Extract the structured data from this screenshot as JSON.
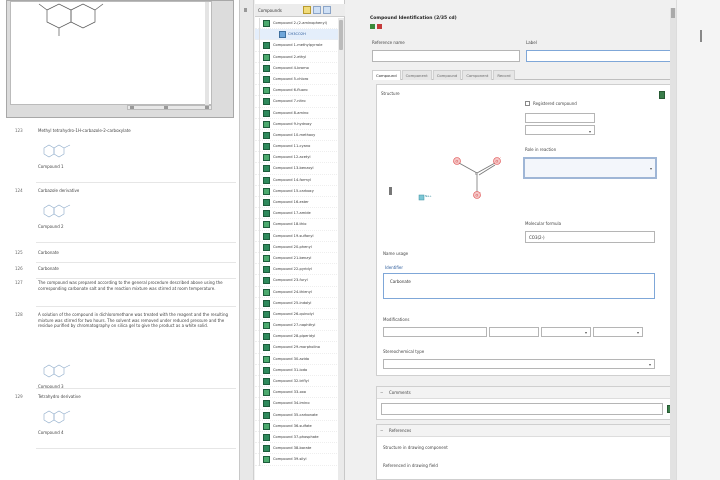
{
  "doc": {
    "rows": [
      {
        "num": "123",
        "text": "Methyl tetrahydro-1H-carbazole-2-carboxylate",
        "thumb": true,
        "sub": "Compound 1"
      },
      {
        "num": "124",
        "text": "Carbazole derivative",
        "thumb": true,
        "sub": "Compound 2"
      },
      {
        "num": "125",
        "text": "Carbonate",
        "thumb": false,
        "sub": ""
      },
      {
        "num": "126",
        "text": "Carbonate",
        "thumb": false,
        "sub": ""
      },
      {
        "num": "127",
        "text": "The compound was prepared according to the general procedure described above using the corresponding carbonate salt and the reaction mixture was stirred at room temperature.",
        "thumb": false,
        "sub": ""
      },
      {
        "num": "128",
        "text": "A solution of the compound in dichloromethane was treated with the reagent and the resulting mixture was stirred for two hours. The solvent was removed under reduced pressure and the residue purified by chromatography on silica gel to give the product as a white solid.",
        "thumb": true,
        "sub": "Compound 3"
      },
      {
        "num": "129",
        "text": "Tetrahydro derivative",
        "thumb": true,
        "sub": "Compound 4"
      }
    ]
  },
  "list": {
    "header": "Compounds",
    "items": [
      {
        "label": "Compound 2-(2-aminophenyl)",
        "child": false
      },
      {
        "label": "CH3CO2H",
        "child": true
      },
      {
        "label": "Compound 1-methylpyrrole",
        "child": false
      },
      {
        "label": "Compound 2-ethyl",
        "child": false
      },
      {
        "label": "Compound 4-bromo",
        "child": false
      },
      {
        "label": "Compound 5-chloro",
        "child": false
      },
      {
        "label": "Compound 6-fluoro",
        "child": false
      },
      {
        "label": "Compound 7-nitro",
        "child": false
      },
      {
        "label": "Compound 8-amino",
        "child": false
      },
      {
        "label": "Compound 9-hydroxy",
        "child": false
      },
      {
        "label": "Compound 10-methoxy",
        "child": false
      },
      {
        "label": "Compound 11-cyano",
        "child": false
      },
      {
        "label": "Compound 12-acetyl",
        "child": false
      },
      {
        "label": "Compound 13-benzoyl",
        "child": false
      },
      {
        "label": "Compound 14-formyl",
        "child": false
      },
      {
        "label": "Compound 15-carboxy",
        "child": false
      },
      {
        "label": "Compound 16-ester",
        "child": false
      },
      {
        "label": "Compound 17-amide",
        "child": false
      },
      {
        "label": "Compound 18-thio",
        "child": false
      },
      {
        "label": "Compound 19-sulfonyl",
        "child": false
      },
      {
        "label": "Compound 20-phenyl",
        "child": false
      },
      {
        "label": "Compound 21-benzyl",
        "child": false
      },
      {
        "label": "Compound 22-pyridyl",
        "child": false
      },
      {
        "label": "Compound 23-furyl",
        "child": false
      },
      {
        "label": "Compound 24-thienyl",
        "child": false
      },
      {
        "label": "Compound 25-indolyl",
        "child": false
      },
      {
        "label": "Compound 26-quinolyl",
        "child": false
      },
      {
        "label": "Compound 27-naphthyl",
        "child": false
      },
      {
        "label": "Compound 28-piperidyl",
        "child": false
      },
      {
        "label": "Compound 29-morpholino",
        "child": false
      },
      {
        "label": "Compound 30-azido",
        "child": false
      },
      {
        "label": "Compound 31-iodo",
        "child": false
      },
      {
        "label": "Compound 32-triflyl",
        "child": false
      },
      {
        "label": "Compound 33-oxo",
        "child": false
      },
      {
        "label": "Compound 34-imino",
        "child": false
      },
      {
        "label": "Compound 35-carbonate",
        "child": false
      },
      {
        "label": "Compound 36-sulfate",
        "child": false
      },
      {
        "label": "Compound 37-phosphate",
        "child": false
      },
      {
        "label": "Compound 38-borate",
        "child": false
      },
      {
        "label": "Compound 39-silyl",
        "child": false
      }
    ]
  },
  "editor": {
    "title": "Compound Identification (2/35 cd)",
    "labels": {
      "reference_name": "Reference name",
      "label": "Label",
      "structure": "Structure",
      "registered_comp": "Registered compound",
      "role_in_reaction": "Role in reaction",
      "molecular_formula": "Molecular formula",
      "name_section": "Name usage",
      "identifier_label": "Identifier",
      "modifications": "Modifications",
      "stereo_type": "Stereochemical type"
    },
    "values": {
      "reference_name": "",
      "label": "",
      "registered_comp_value": "",
      "role_value": "",
      "molecular_formula": "CO3(2-)",
      "name_value": "Carbonate",
      "mod_a": "",
      "mod_b": "",
      "stereo_value": ""
    },
    "tabs": [
      "Compound",
      "Component",
      "Compound",
      "Component",
      "Record"
    ],
    "structure": {
      "center": "C",
      "atoms": [
        "O",
        "O",
        "O"
      ],
      "charges": [
        "-",
        "-"
      ],
      "counter_ion": "Na+"
    },
    "sections": {
      "comments": "Comments",
      "references": "References",
      "ref_item_1": "Structure in drawing component",
      "ref_item_2": "Referenced in drawing field"
    }
  }
}
